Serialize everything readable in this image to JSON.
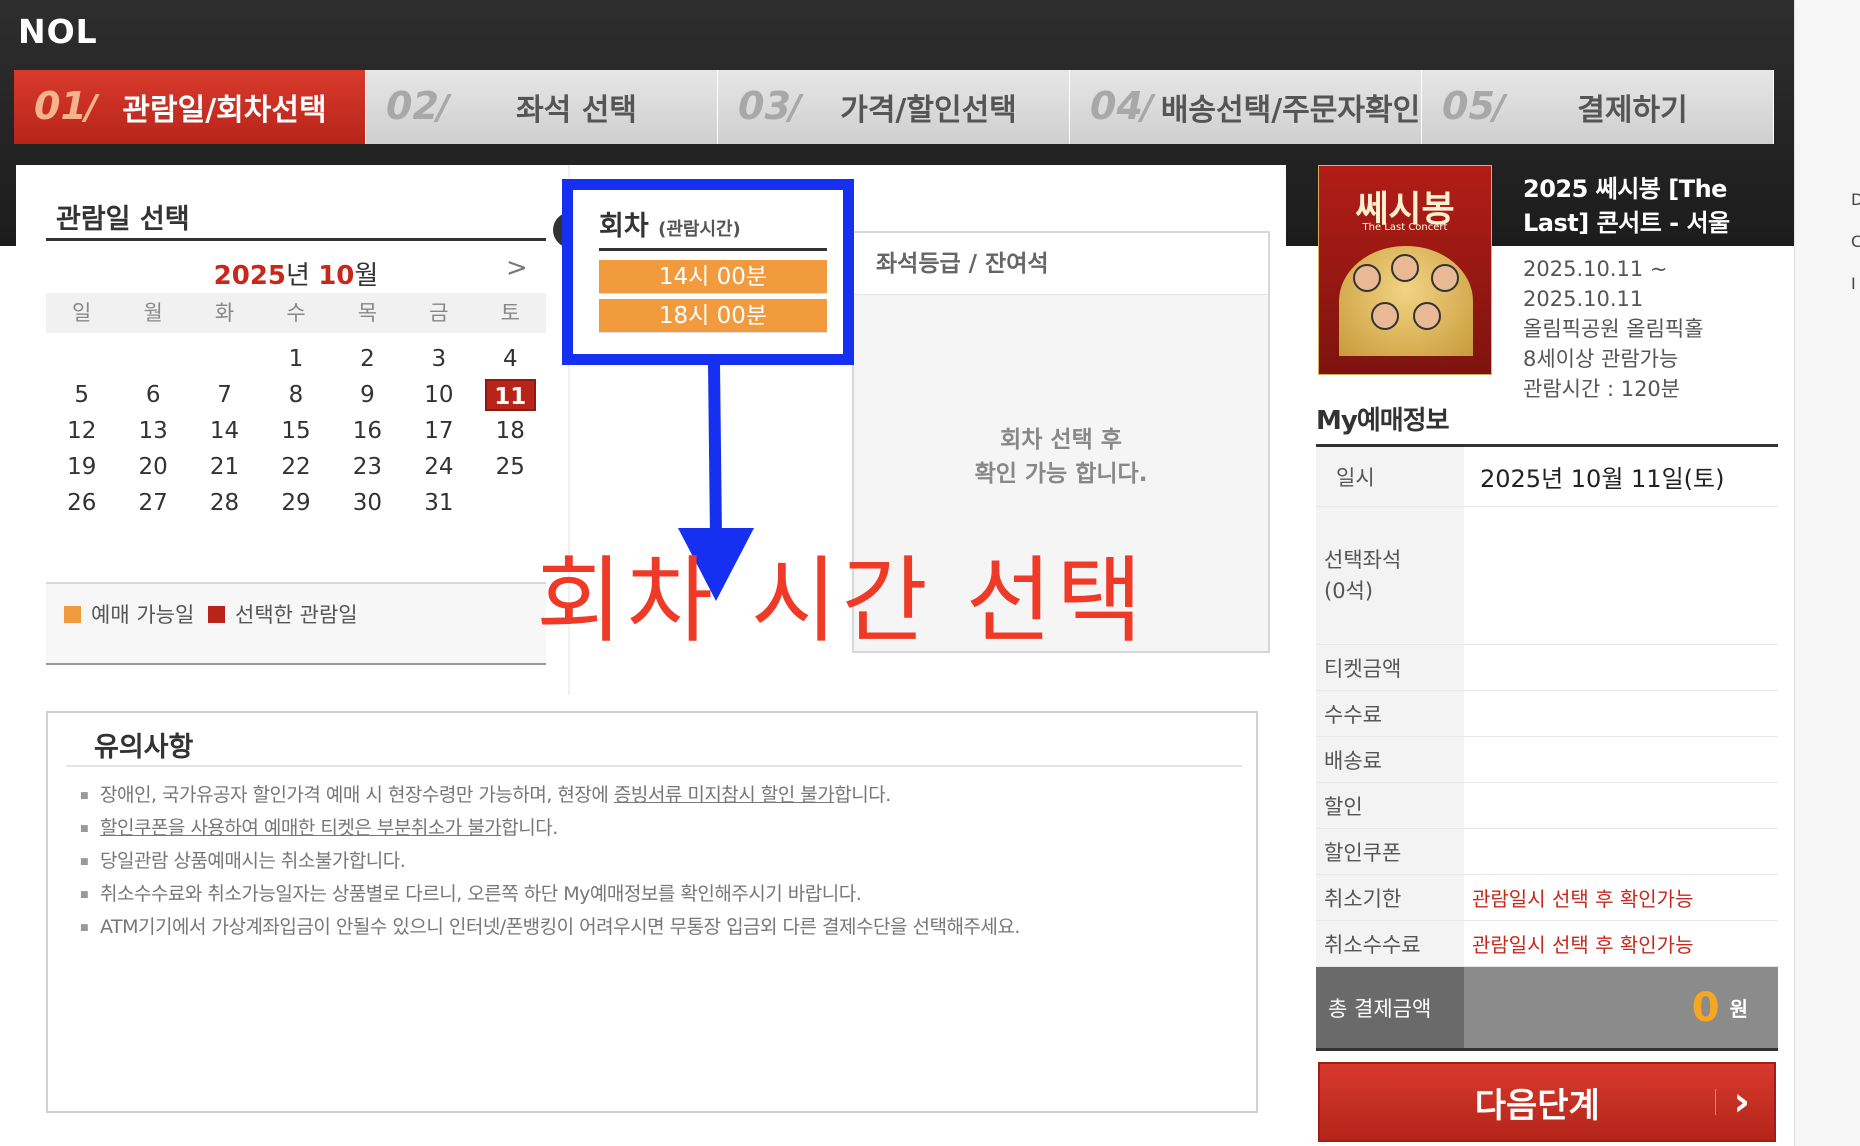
{
  "brand": "NOL",
  "steps": [
    {
      "num": "01",
      "label": "관람일/회차선택"
    },
    {
      "num": "02",
      "label": "좌석 선택"
    },
    {
      "num": "03",
      "label": "가격/할인선택"
    },
    {
      "num": "04",
      "label": "배송선택/주문자확인"
    },
    {
      "num": "05",
      "label": "결제하기"
    }
  ],
  "calendar": {
    "title": "관람일 선택",
    "year": "2025",
    "year_suffix": "년 ",
    "month": "10",
    "month_suffix": "월",
    "next_icon": ">",
    "weekdays": [
      "일",
      "월",
      "화",
      "수",
      "목",
      "금",
      "토"
    ],
    "days": [
      "",
      "",
      "",
      "1",
      "2",
      "3",
      "4",
      "5",
      "6",
      "7",
      "8",
      "9",
      "10",
      "11",
      "12",
      "13",
      "14",
      "15",
      "16",
      "17",
      "18",
      "19",
      "20",
      "21",
      "22",
      "23",
      "24",
      "25",
      "26",
      "27",
      "28",
      "29",
      "30",
      "31",
      ""
    ],
    "selected_day": "11",
    "legend": {
      "available": "예매 가능일",
      "selected": "선택한 관람일"
    },
    "colors": {
      "available": "#f19a3e",
      "selected": "#b8241a"
    }
  },
  "session": {
    "title": "회차",
    "subtitle": "(관람시간)",
    "times": [
      "14시 00분",
      "18시 00분"
    ]
  },
  "seat": {
    "header": "좌석등급 / 잔여석",
    "message_line1": "회차 선택 후",
    "message_line2": "확인 가능 합니다."
  },
  "annotation": "회차 시간 선택",
  "notice": {
    "title": "유의사항",
    "item1_a": "장애인, 국가유공자 할인가격 예매 시 현장수령만 가능하며, 현장에 ",
    "item1_u": "증빙서류 미지참시 할인 불가",
    "item1_b": "합니다.",
    "item2_u": "할인쿠폰을 사용하여 예매한 티켓은 부분취소가 불가",
    "item2_b": "합니다.",
    "item3": "당일관람 상품예매시는 취소불가합니다.",
    "item4": "취소수수료와 취소가능일자는 상품별로 다르니, 오른쪽 하단 My예매정보를 확인해주시기 바랍니다.",
    "item5": "ATM기기에서 가상계좌입금이 안될수 있으니 인터넷/폰뱅킹이 어려우시면 무통장 입금외 다른 결제수단을 선택해주세요."
  },
  "poster": {
    "title": "쎄시봉",
    "subtitle": "The Last Concert",
    "footer": "올림픽공원 올림픽홀"
  },
  "event": {
    "title": "2025 쎄시봉 [The Last] 콘서트 - 서울",
    "date_start": "2025.10.11 ~",
    "date_end": "2025.10.11",
    "venue": "올림픽공원 올림픽홀",
    "age": "8세이상 관람가능",
    "runtime": "관람시간 : 120분"
  },
  "my": {
    "title": "My예매정보",
    "date_label": "일시",
    "date_value": "2025년 10월 11일(토)",
    "seat_label_1": "선택좌석",
    "seat_label_2": "(0석)",
    "ticket_label": "티켓금액",
    "fee_label": "수수료",
    "delivery_label": "배송료",
    "discount_label": "할인",
    "coupon_label": "할인쿠폰",
    "cancel_deadline_label": "취소기한",
    "cancel_deadline_value": "관람일시 선택 후 확인가능",
    "cancel_fee_label": "취소수수료",
    "cancel_fee_value": "관람일시 선택 후 확인가능",
    "total_label": "총 결제금액",
    "total_amount": "0",
    "total_unit": "원"
  },
  "next_button": "다음단계",
  "edge_letters": [
    "D",
    "C",
    "I"
  ]
}
